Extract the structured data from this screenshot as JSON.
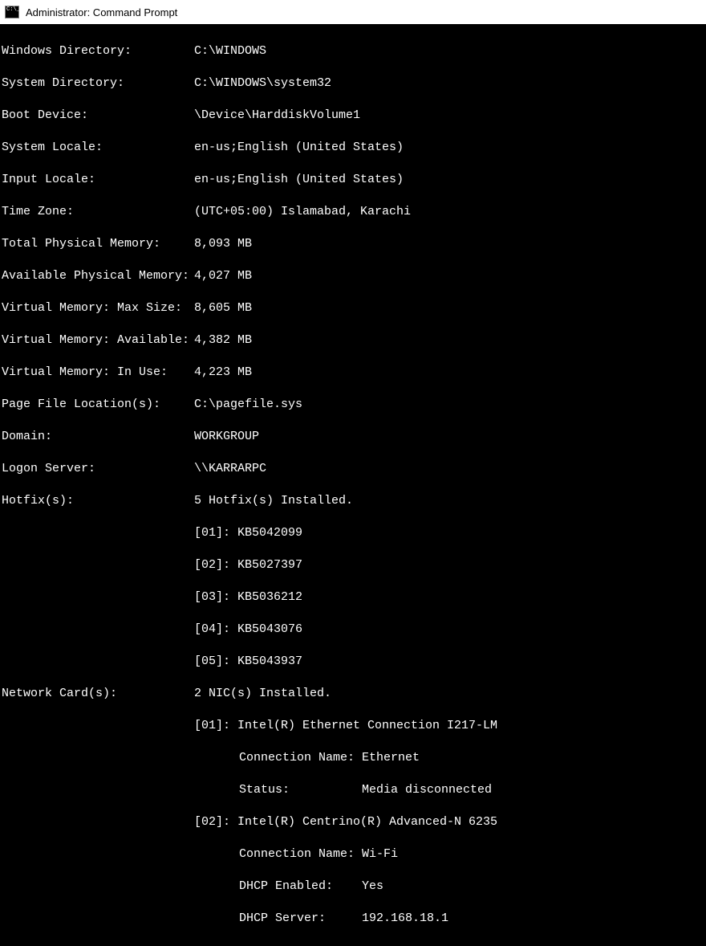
{
  "window": {
    "title": "Administrator: Command Prompt"
  },
  "fields": {
    "windows_directory": {
      "label": "Windows Directory:",
      "value": "C:\\WINDOWS"
    },
    "system_directory": {
      "label": "System Directory:",
      "value": "C:\\WINDOWS\\system32"
    },
    "boot_device": {
      "label": "Boot Device:",
      "value": "\\Device\\HarddiskVolume1"
    },
    "system_locale": {
      "label": "System Locale:",
      "value": "en-us;English (United States)"
    },
    "input_locale": {
      "label": "Input Locale:",
      "value": "en-us;English (United States)"
    },
    "time_zone": {
      "label": "Time Zone:",
      "value": "(UTC+05:00) Islamabad, Karachi"
    },
    "total_physical_memory": {
      "label": "Total Physical Memory:",
      "value": "8,093 MB"
    },
    "available_physical_memory": {
      "label": "Available Physical Memory:",
      "value": "4,027 MB"
    },
    "virtual_memory_max": {
      "label": "Virtual Memory: Max Size:",
      "value": "8,605 MB"
    },
    "virtual_memory_available": {
      "label": "Virtual Memory: Available:",
      "value": "4,382 MB"
    },
    "virtual_memory_in_use": {
      "label": "Virtual Memory: In Use:",
      "value": "4,223 MB"
    },
    "page_file_location": {
      "label": "Page File Location(s):",
      "value": "C:\\pagefile.sys"
    },
    "domain": {
      "label": "Domain:",
      "value": "WORKGROUP"
    },
    "logon_server": {
      "label": "Logon Server:",
      "value": "\\\\KARRARPC"
    },
    "hotfix": {
      "label": "Hotfix(s):",
      "value": "5 Hotfix(s) Installed."
    },
    "hotfix_list": {
      "0": "[01]: KB5042099",
      "1": "[02]: KB5027397",
      "2": "[03]: KB5036212",
      "3": "[04]: KB5043076",
      "4": "[05]: KB5043937"
    },
    "network_cards": {
      "label": "Network Card(s):",
      "value": "2 NIC(s) Installed."
    },
    "nic1": {
      "header": "[01]: Intel(R) Ethernet Connection I217-LM",
      "connection_name": "Connection Name: Ethernet",
      "status": "Status:          Media disconnected"
    },
    "nic2": {
      "header": "[02]: Intel(R) Centrino(R) Advanced-N 6235",
      "connection_name": "Connection Name: Wi-Fi",
      "dhcp_enabled": "DHCP Enabled:    Yes",
      "dhcp_server": "DHCP Server:     192.168.18.1"
    }
  }
}
